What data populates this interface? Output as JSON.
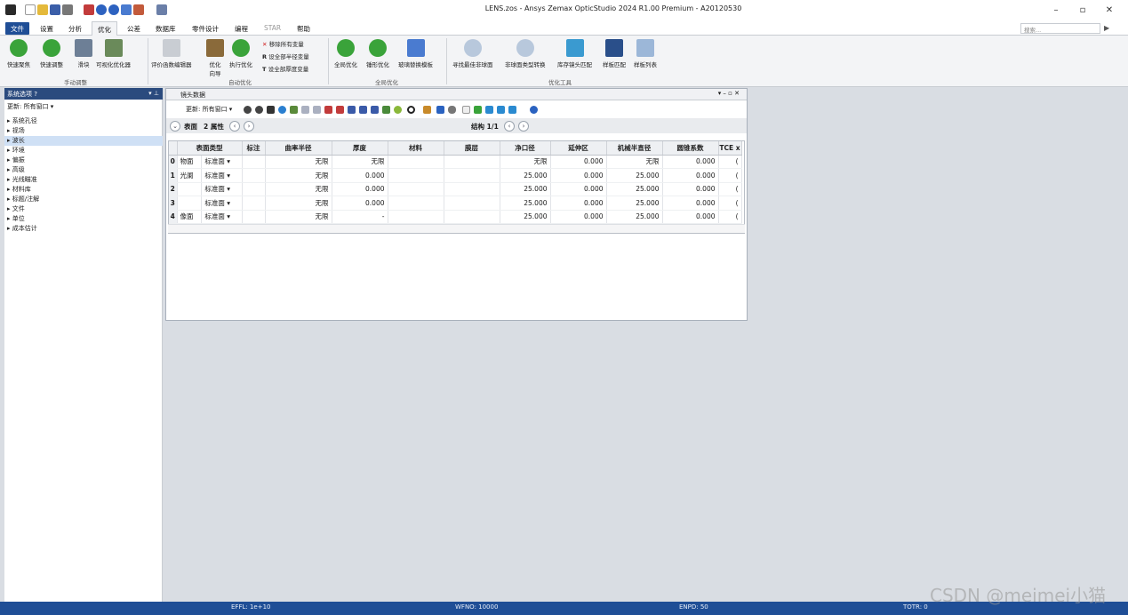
{
  "app": {
    "title": "LENS.zos - Ansys Zemax OpticStudio 2024 R1.00   Premium - A20120530",
    "min": "–",
    "restore": "▫",
    "close": "✕"
  },
  "menus": {
    "file": "文件",
    "settings": "设置",
    "analyze": "分析",
    "optimize": "优化",
    "tolerance": "公差",
    "library": "数据库",
    "part_design": "零件设计",
    "programming": "编程",
    "star": "STAR",
    "help": "帮助"
  },
  "search_placeholder": "搜索...",
  "ribbon": {
    "quick_focus": "快速聚焦",
    "quick_adjust": "快速调整",
    "slider": "滑块",
    "visual_opt": "可视化优化器",
    "group_manual": "手动调整",
    "merit_editor": "评价函数编辑器",
    "opt_wizard": "优化\n向导",
    "execute_opt": "执行优化",
    "remove_vars": "移除所有变量",
    "set_radius_vars": "设全部半径变量",
    "set_thick_vars": "设全部厚度变量",
    "group_auto": "自动优化",
    "global_opt": "全局优化",
    "hammer_opt": "锤形优化",
    "glass_sub": "玻璃替换模板",
    "group_global": "全局优化",
    "find_asphere": "寻找最佳非球面",
    "asphere_conv": "非球面类型转换",
    "stock_lens": "库存镜头匹配",
    "test_plate": "样板匹配",
    "test_plate_list": "样板列表",
    "group_tools": "优化工具"
  },
  "left_panel": {
    "title": "系统选项",
    "update": "更新: 所有窗口 ▾",
    "items": [
      "系统孔径",
      "视场",
      "波长",
      "环境",
      "偏振",
      "高级",
      "光线瞄准",
      "材料库",
      "标题/注解",
      "文件",
      "单位",
      "成本估计"
    ]
  },
  "editor": {
    "title": "镜头数据",
    "update": "更新: 所有窗口 ▾",
    "surface": "表面",
    "props": "2 属性",
    "config": "结构 1/1",
    "columns": [
      "表面类型",
      "标注",
      "曲率半径",
      "厚度",
      "材料",
      "膜层",
      "净口径",
      "延伸区",
      "机械半直径",
      "圆锥系数",
      "TCE x"
    ],
    "rows": [
      [
        "0",
        "物面",
        "标准面 ▾",
        "",
        "无限",
        "无限",
        "",
        "",
        "无限",
        "0.000",
        "无限",
        "0.000",
        "("
      ],
      [
        "1",
        "光阑",
        "标准面 ▾",
        "",
        "无限",
        "0.000",
        "",
        "",
        "25.000",
        "0.000",
        "25.000",
        "0.000",
        "("
      ],
      [
        "2",
        "",
        "标准面 ▾",
        "",
        "无限",
        "0.000",
        "",
        "",
        "25.000",
        "0.000",
        "25.000",
        "0.000",
        "("
      ],
      [
        "3",
        "",
        "标准面 ▾",
        "",
        "无限",
        "0.000",
        "",
        "",
        "25.000",
        "0.000",
        "25.000",
        "0.000",
        "("
      ],
      [
        "4",
        "像面",
        "标准面 ▾",
        "",
        "无限",
        "-",
        "",
        "",
        "25.000",
        "0.000",
        "25.000",
        "0.000",
        "("
      ]
    ]
  },
  "status": {
    "effl": "EFFL: 1e+10",
    "wfno": "WFNO: 10000",
    "enpd": "ENPD: 50",
    "totr": "TOTR: 0"
  },
  "watermark": "CSDN @meimei小猫",
  "colors": {
    "accent": "#1f4e96",
    "green": "#3aa33a",
    "panel_header": "#2b4b7e"
  }
}
